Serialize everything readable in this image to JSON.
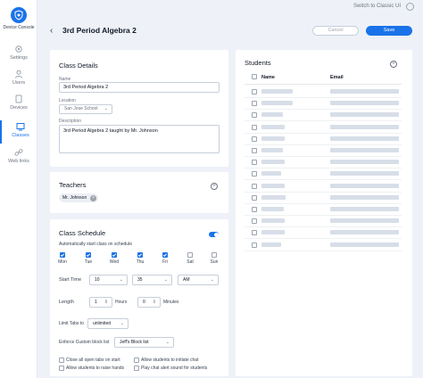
{
  "sidebar": {
    "logo_label": "Device Console",
    "items": [
      {
        "label": "Settings",
        "icon": "gear-icon",
        "active": false
      },
      {
        "label": "Users",
        "icon": "user-icon",
        "active": false
      },
      {
        "label": "Devices",
        "icon": "device-icon",
        "active": false
      },
      {
        "label": "Classes",
        "icon": "classes-icon",
        "active": true
      },
      {
        "label": "Web links",
        "icon": "link-icon",
        "active": false
      }
    ]
  },
  "topbar": {
    "switch_label": "Switch to Classic UI"
  },
  "header": {
    "title": "3rd Period Algebra 2",
    "cancel_label": "Cancel",
    "save_label": "Save"
  },
  "class_details": {
    "title": "Class Details",
    "name_label": "Name",
    "name_value": "3rd Period Algebra 2",
    "location_label": "Location",
    "location_value": "San Jose School",
    "description_label": "Description",
    "description_value": "3rd Period Algebra 2 taught by Mr. Johnson"
  },
  "teachers": {
    "title": "Teachers",
    "chips": [
      "Mr. Johnson"
    ]
  },
  "schedule": {
    "title": "Class Schedule",
    "auto_start_label": "Automatically start class on schedule",
    "auto_start_on": true,
    "days": [
      {
        "label": "Mon",
        "checked": true
      },
      {
        "label": "Tue",
        "checked": true
      },
      {
        "label": "Wed",
        "checked": true
      },
      {
        "label": "Thu",
        "checked": true
      },
      {
        "label": "Fri",
        "checked": true
      },
      {
        "label": "Sat",
        "checked": false
      },
      {
        "label": "Sun",
        "checked": false
      }
    ],
    "start_time_label": "Start Time",
    "start_hour": "10",
    "start_minute": "35",
    "start_ampm": "AM",
    "length_label": "Length",
    "length_hours": "1",
    "hours_label": "Hours",
    "length_minutes": "0",
    "minutes_label": "Minutes",
    "limit_tabs_label": "Limit Tabs to",
    "limit_tabs_value": "unlimited",
    "blocklist_label": "Enforce Custom block list",
    "blocklist_value": "Jeff's Block list",
    "options": [
      {
        "label": "Close all open tabs on start",
        "checked": false
      },
      {
        "label": "Allow students to initiate chat",
        "checked": false
      },
      {
        "label": "Allow students to raise hands",
        "checked": false
      },
      {
        "label": "Play chat alert sound for students",
        "checked": false
      }
    ]
  },
  "students": {
    "title": "Students",
    "col_name": "Name",
    "col_email": "Email",
    "row_count": 14
  }
}
